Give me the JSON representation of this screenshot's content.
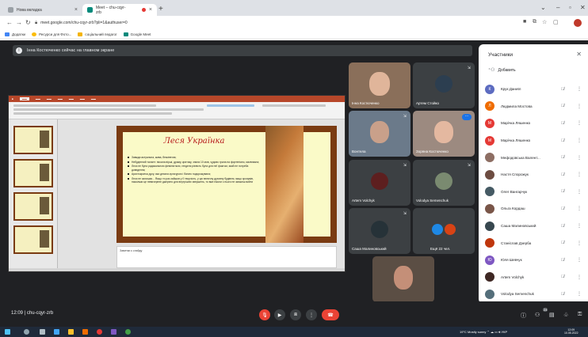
{
  "browser": {
    "tabs": [
      {
        "label": "Нова вкладка"
      },
      {
        "label": "Meet – chu-cqyr-zrb"
      }
    ],
    "url": "meet.google.com/chu-cqyr-zrb?pli=1&authuser=0",
    "bookmarks": [
      "Додатки",
      "Ресурси для Фото...",
      "соціальний педагог",
      "Google Meet"
    ]
  },
  "meet": {
    "presenting_banner": "Інна Костюченко сейчас на главном экране",
    "meeting_info": "12:09 | chu-cqyr-zrb",
    "participants_badge": "24"
  },
  "shared_screen": {
    "slide_title": "Леся Українка",
    "bullets": [
      "Завжди актуальна, жива, безкінечна;",
      "Небуденний талант: писала вірші, драму, критику, знала 10 мов, чудово грала на фортепіано, малювала;",
      "Леся не була радикальною феміністкою, генделя рівність була для неї фактом, який не потреба доведення;",
      "Аристократка духу, яка дехала культурою і багато подорожувала;",
      "Леся не залишає... Якщо ти раз зайшов у її творчість, у цю величну духовну будівлю, якщо зрозумів, наскільки це невичерпне джерело для внутрішніх звершень, то вже ніколи з нього не зможеш вийти"
    ],
    "notes_placeholder": "Заметки к слайду"
  },
  "tiles": [
    {
      "name": "Інна Костюченко"
    },
    {
      "name": "Артем Стойко"
    },
    {
      "name": "Вонтела"
    },
    {
      "name": "Зоряна Костюченко"
    },
    {
      "name": "Artem Volchyk"
    },
    {
      "name": "Volodya Semenchuk"
    },
    {
      "name": "Саша Малиновський"
    },
    {
      "name": "Ещё 22 чел."
    },
    {
      "name": ""
    }
  ],
  "panel": {
    "title": "Участники",
    "add_label": "Добавить",
    "people": [
      {
        "initial": "К",
        "name": "Крук Даниїл",
        "color": "#5c6bc0"
      },
      {
        "initial": "Л",
        "name": "Людмила Мостова",
        "color": "#ef6c00"
      },
      {
        "initial": "М",
        "name": "Марічка Ляшенко",
        "color": "#e53935"
      },
      {
        "initial": "М",
        "name": "Марічка Ляшенко",
        "color": "#e53935"
      },
      {
        "initial": "",
        "name": "Мефодовська Валент...",
        "color": "#8d6e63"
      },
      {
        "initial": "",
        "name": "Настя Спорожук",
        "color": "#6d4c41"
      },
      {
        "initial": "",
        "name": "Олег Вангарчук",
        "color": "#455a64"
      },
      {
        "initial": "",
        "name": "Ольга Кордаш",
        "color": "#795548"
      },
      {
        "initial": "",
        "name": "Саша Малиновський",
        "color": "#37474f"
      },
      {
        "initial": "",
        "name": "Станіслав Дзерба",
        "color": "#bf360c"
      },
      {
        "initial": "Ю",
        "name": "Юля Шевчук",
        "color": "#7e57c2"
      },
      {
        "initial": "",
        "name": "Artem Volchyk",
        "color": "#3e2723"
      },
      {
        "initial": "",
        "name": "Volodya Semenchuk",
        "color": "#546e7a"
      }
    ]
  },
  "taskbar": {
    "weather": "19°C Mostly sunny",
    "lang": "УКР",
    "time": "12:09",
    "date": "10.05.2022"
  }
}
